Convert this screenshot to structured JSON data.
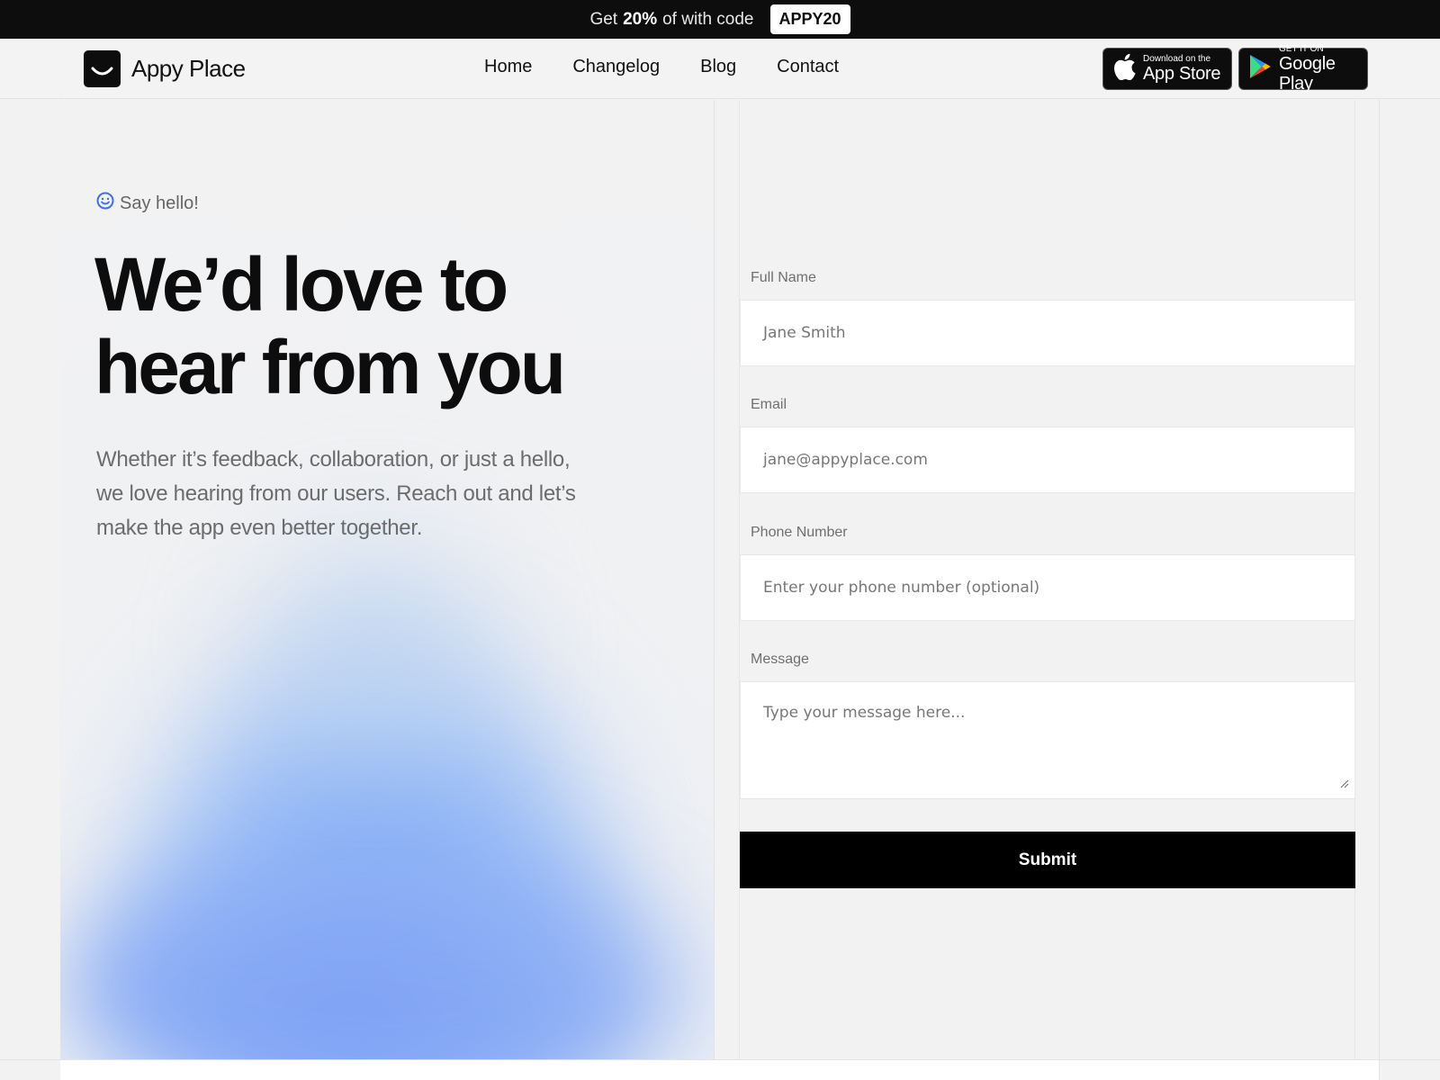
{
  "promo": {
    "prefix": "Get",
    "percent": "20%",
    "suffix": "of with code",
    "code": "APPY20"
  },
  "header": {
    "brand": "Appy Place",
    "nav": [
      "Home",
      "Changelog",
      "Blog",
      "Contact"
    ],
    "app_store": {
      "small": "Download on the",
      "big": "App Store"
    },
    "google_play": {
      "small": "GET IT ON",
      "big": "Google Play"
    }
  },
  "hero": {
    "eyebrow": "Say hello!",
    "headline": "We’d love to hear from you",
    "lead": "Whether it’s feedback, collaboration, or just a hello, we love hearing from our users. Reach out and let’s make the app even better together."
  },
  "form": {
    "full_name_label": "Full Name",
    "full_name_value": "Jane Smith",
    "email_label": "Email",
    "email_value": "jane@appyplace.com",
    "phone_label": "Phone Number",
    "phone_placeholder": "Enter your phone number (optional)",
    "message_label": "Message",
    "message_placeholder": "Type your message here...",
    "submit_label": "Submit"
  },
  "colors": {
    "accent_blue": "#3b6ef0",
    "dark": "#0d0d0d"
  },
  "icons": [
    "smile-logo-icon",
    "apple-icon",
    "google-play-icon",
    "smiley-icon",
    "resize-handle-icon"
  ]
}
